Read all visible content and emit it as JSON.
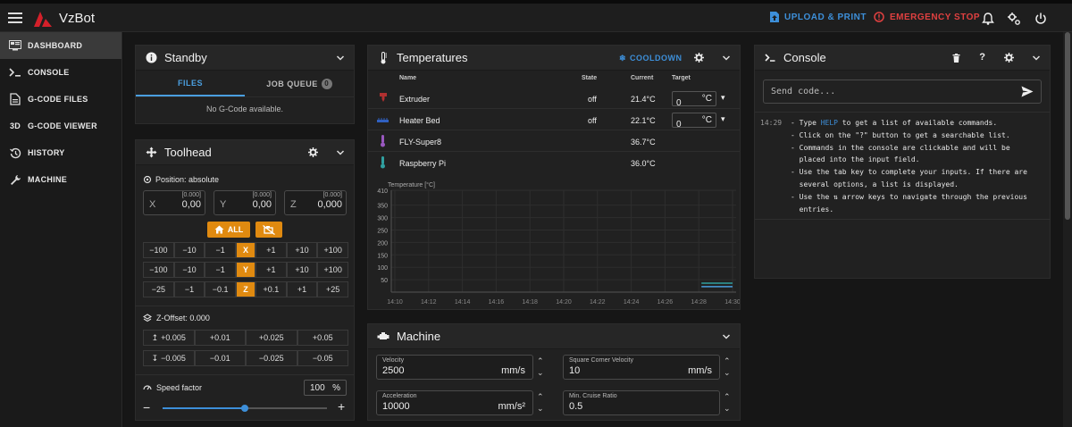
{
  "app": {
    "brand": "VzBot"
  },
  "topbar": {
    "upload_label": "UPLOAD & PRINT",
    "emergency_label": "EMERGENCY STOP"
  },
  "sidebar": {
    "items": [
      {
        "label": "DASHBOARD",
        "icon": "monitor-icon"
      },
      {
        "label": "CONSOLE",
        "icon": "terminal-icon"
      },
      {
        "label": "G-CODE FILES",
        "icon": "file-icon"
      },
      {
        "label": "G-CODE VIEWER",
        "icon": "3d-icon"
      },
      {
        "label": "HISTORY",
        "icon": "history-icon"
      },
      {
        "label": "MACHINE",
        "icon": "wrench-icon"
      }
    ],
    "viewer_badge": "3D"
  },
  "standby": {
    "title": "Standby",
    "tab_files": "FILES",
    "tab_queue": "JOB QUEUE",
    "queue_count": "0",
    "empty_text": "No G-Code available."
  },
  "toolhead": {
    "title": "Toolhead",
    "position_label": "Position: absolute",
    "x": {
      "label": "X",
      "value": "0,00",
      "hint": "[0.000]"
    },
    "y": {
      "label": "Y",
      "value": "0,00",
      "hint": "[0.000]"
    },
    "z": {
      "label": "Z",
      "value": "0,000",
      "hint": "[0.000]"
    },
    "home_all": "ALL",
    "row_x": [
      "−100",
      "−10",
      "−1",
      "X",
      "+1",
      "+10",
      "+100"
    ],
    "row_y": [
      "−100",
      "−10",
      "−1",
      "Y",
      "+1",
      "+10",
      "+100"
    ],
    "row_z": [
      "−25",
      "−1",
      "−0.1",
      "Z",
      "+0.1",
      "+1",
      "+25"
    ],
    "zoffset_label": "Z-Offset: 0.000",
    "zoff_up": [
      "+0.005",
      "+0.01",
      "+0.025",
      "+0.05"
    ],
    "zoff_down": [
      "−0.005",
      "−0.01",
      "−0.025",
      "−0.05"
    ],
    "speed_label": "Speed factor",
    "speed_value": "100",
    "speed_unit": "%",
    "speed_fraction": 0.5
  },
  "temps": {
    "title": "Temperatures",
    "cooldown": "COOLDOWN",
    "headers": {
      "name": "Name",
      "state": "State",
      "current": "Current",
      "target": "Target"
    },
    "rows": [
      {
        "name": "Extruder",
        "state": "off",
        "current": "21.4°C",
        "target": "0",
        "unit": "°C"
      },
      {
        "name": "Heater Bed",
        "state": "off",
        "current": "22.1°C",
        "target": "0",
        "unit": "°C"
      },
      {
        "name": "FLY-Super8",
        "state": "",
        "current": "36.7°C"
      },
      {
        "name": "Raspberry Pi",
        "state": "",
        "current": "36.0°C"
      }
    ],
    "colors": {
      "extruder": "#b03030",
      "bed": "#3060c0",
      "fly": "#9a58c0",
      "pi": "#30a0a0"
    }
  },
  "chart_data": {
    "type": "line",
    "ylabel": "Temperature [°C]",
    "y_ticks": [
      "410",
      "350",
      "300",
      "250",
      "200",
      "150",
      "100",
      "50"
    ],
    "x_ticks": [
      "14:10",
      "14:12",
      "14:14",
      "14:16",
      "14:18",
      "14:20",
      "14:22",
      "14:24",
      "14:26",
      "14:28",
      "14:30"
    ],
    "ylim": [
      0,
      410
    ],
    "grid": true,
    "series": [
      {
        "color": "#30a0a0",
        "x": [
          "14:28",
          "14:30"
        ],
        "y": [
          36,
          36
        ]
      },
      {
        "color": "#4a9fe0",
        "x": [
          "14:28",
          "14:30"
        ],
        "y": [
          22,
          22
        ]
      }
    ]
  },
  "machine": {
    "title": "Machine",
    "velocity": {
      "label": "Velocity",
      "value": "2500",
      "unit": "mm/s"
    },
    "scv": {
      "label": "Square Corner Velocity",
      "value": "10",
      "unit": "mm/s"
    },
    "accel": {
      "label": "Acceleration",
      "value": "10000",
      "unit": "mm/s²"
    },
    "mcr": {
      "label": "Min. Cruise Ratio",
      "value": "0.5"
    }
  },
  "console": {
    "title": "Console",
    "help_label": "?",
    "placeholder": "Send code...",
    "time": "14:29",
    "lines": [
      "- Type ",
      "- Click on the \"?\" button to get a searchable list.",
      "- Commands in the console are clickable and will be",
      "  placed into the input field.",
      "- Use the tab key to complete your inputs. If there are",
      "  several options, a list is displayed.",
      "- Use the ⇅ arrow keys to navigate through the previous",
      "  entries."
    ],
    "help_word": "HELP",
    "line0_tail": " to get a list of available commands."
  }
}
